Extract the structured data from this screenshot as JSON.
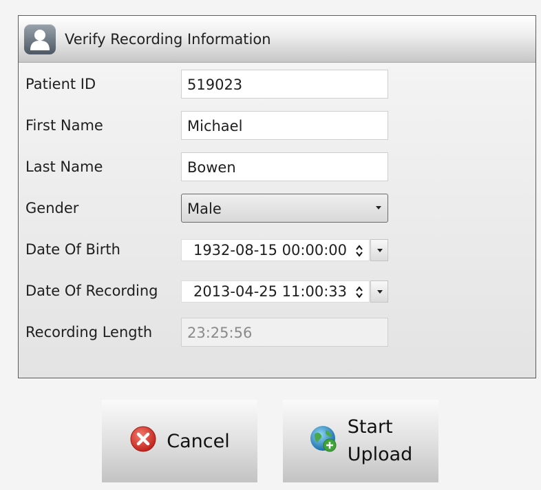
{
  "dialog": {
    "title": "Verify Recording Information",
    "icon": "user-icon"
  },
  "fields": {
    "patient_id": {
      "label": "Patient ID",
      "value": "519023"
    },
    "first_name": {
      "label": "First Name",
      "value": "Michael"
    },
    "last_name": {
      "label": "Last Name",
      "value": "Bowen"
    },
    "gender": {
      "label": "Gender",
      "value": "Male"
    },
    "date_of_birth": {
      "label": "Date Of Birth",
      "value": "1932-08-15 00:00:00"
    },
    "date_of_recording": {
      "label": "Date Of Recording",
      "value": "2013-04-25 11:00:33"
    },
    "recording_length": {
      "label": "Recording Length",
      "value": "23:25:56"
    }
  },
  "buttons": {
    "cancel": {
      "label": "Cancel",
      "icon": "cancel-icon",
      "color": "#d9302a"
    },
    "start_upload": {
      "label_line1": "Start",
      "label_line2": "Upload",
      "icon": "globe-icon"
    }
  }
}
